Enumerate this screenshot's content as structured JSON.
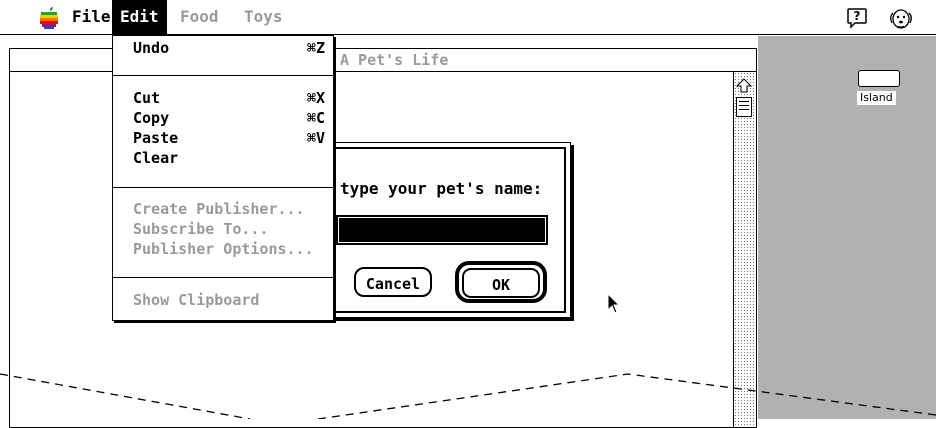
{
  "menubar": {
    "apple_icon": "apple-logo-icon",
    "menus": [
      {
        "label": "File"
      },
      {
        "label": "Edit"
      },
      {
        "label": "Food"
      },
      {
        "label": "Toys"
      }
    ],
    "help_icon": "help-balloon-icon",
    "app_icon": "dog-face-icon"
  },
  "window": {
    "title": "A Pet's Life"
  },
  "desktop": {
    "volume_label": "Island"
  },
  "dialog": {
    "prompt": "type your pet's name:",
    "name_value": "",
    "cancel_label": "Cancel",
    "ok_label": "OK"
  },
  "edit_menu": {
    "items": [
      {
        "label": "Undo",
        "shortcut": "⌘Z",
        "enabled": true
      },
      {
        "label": "Cut",
        "shortcut": "⌘X",
        "enabled": true
      },
      {
        "label": "Copy",
        "shortcut": "⌘C",
        "enabled": true
      },
      {
        "label": "Paste",
        "shortcut": "⌘V",
        "enabled": true
      },
      {
        "label": "Clear",
        "shortcut": "",
        "enabled": true
      },
      {
        "label": "Create Publisher...",
        "shortcut": "",
        "enabled": false
      },
      {
        "label": "Subscribe To...",
        "shortcut": "",
        "enabled": false
      },
      {
        "label": "Publisher Options...",
        "shortcut": "",
        "enabled": false
      },
      {
        "label": "Show Clipboard",
        "shortcut": "",
        "enabled": false
      }
    ]
  },
  "colors": {
    "desktop_gray": "#b1b1b1",
    "disabled_text": "#9a9a9a"
  }
}
